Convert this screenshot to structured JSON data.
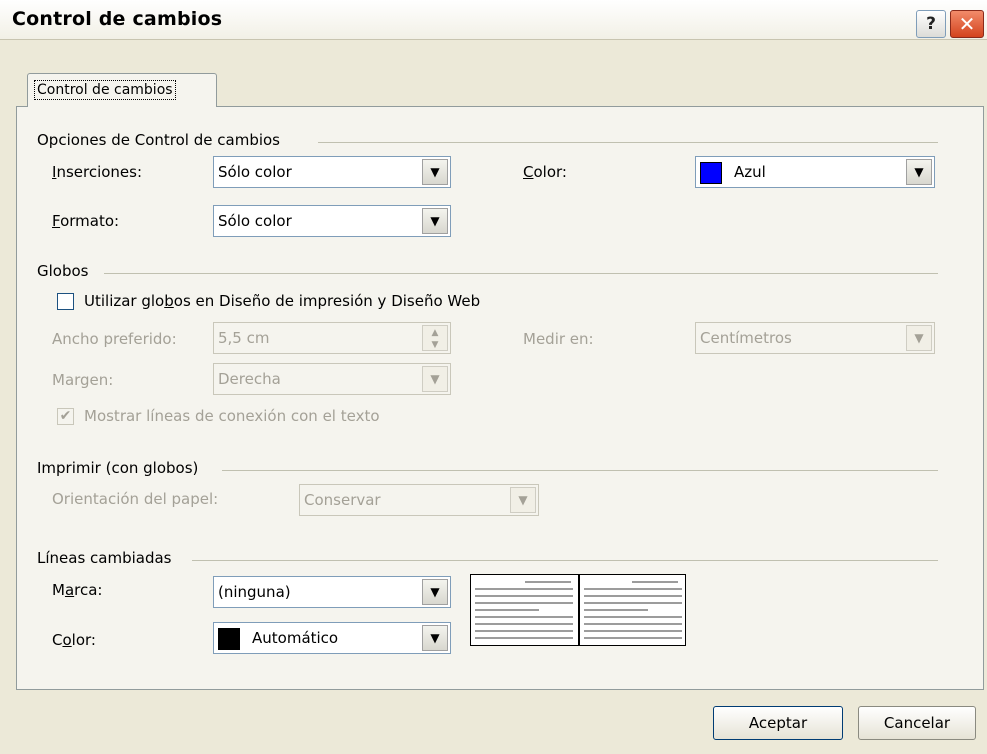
{
  "dialog": {
    "title": "Control de cambios",
    "help_label": "?",
    "close_label": "✕"
  },
  "tab": {
    "label": "Control de cambios"
  },
  "options": {
    "header": "Opciones de Control de cambios",
    "insertions": {
      "label_key": "I",
      "label_rest": "nserciones:",
      "value": "Sólo color"
    },
    "format": {
      "label_key": "F",
      "label_rest": "ormato:",
      "value": "Sólo color"
    },
    "color": {
      "label_key": "C",
      "label_rest": "olor:",
      "value": "Azul",
      "swatch": "#0000ff"
    }
  },
  "balloons": {
    "header": "Globos",
    "use_balloons": {
      "label_pre": "Utilizar glo",
      "label_key": "b",
      "label_post": "os en Diseño de impresión y Diseño Web",
      "checked": false
    },
    "preferred_width": {
      "label": "Ancho preferido:",
      "value": "5,5 cm"
    },
    "measure_in": {
      "label": "Medir en:",
      "value": "Centímetros"
    },
    "margin": {
      "label": "Margen:",
      "value": "Derecha"
    },
    "show_lines": {
      "label": "Mostrar líneas de conexión con el texto",
      "checked": true,
      "check_glyph": "✔"
    }
  },
  "print": {
    "header": "Imprimir (con globos)",
    "orientation": {
      "label": "Orientación del papel:",
      "value": "Conservar"
    }
  },
  "changed_lines": {
    "header": "Líneas cambiadas",
    "mark": {
      "label_pre": "M",
      "label_key": "a",
      "label_post": "rca:",
      "value": "(ninguna)"
    },
    "color": {
      "label_pre": "C",
      "label_key": "o",
      "label_post": "lor:",
      "value": "Automático",
      "swatch": "#000000"
    }
  },
  "icons": {
    "dropdown_arrow": "▼",
    "spin_up": "▲",
    "spin_down": "▼"
  },
  "buttons": {
    "ok": "Aceptar",
    "cancel": "Cancelar"
  }
}
